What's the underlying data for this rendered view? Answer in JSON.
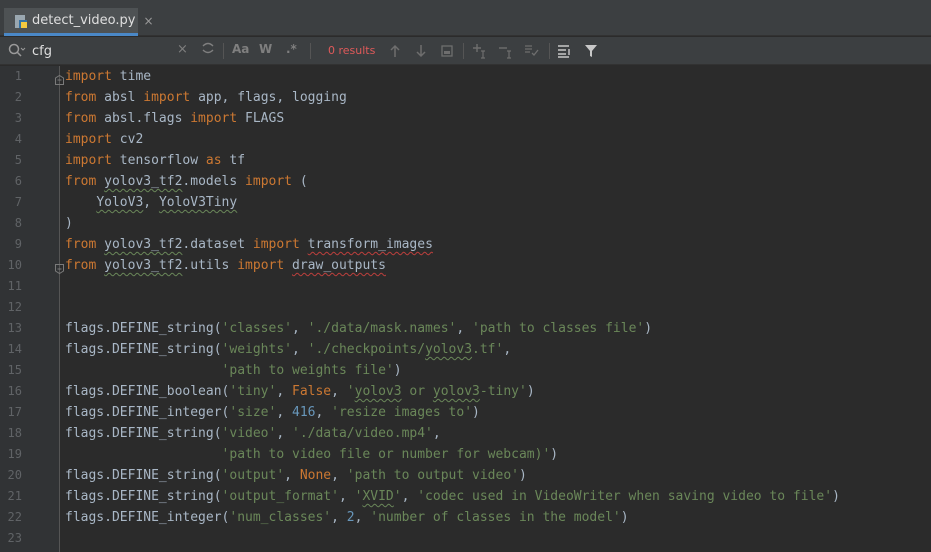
{
  "tab": {
    "label": "detect_video.py",
    "close": "×"
  },
  "find": {
    "query": "cfg",
    "clear": "×",
    "match_case": "Aa",
    "words": "W",
    "regex": ".*",
    "results": "0 results"
  },
  "lines": [
    {
      "n": "1",
      "tokens": [
        [
          "kw",
          "import"
        ],
        [
          "",
          " time"
        ]
      ]
    },
    {
      "n": "2",
      "tokens": [
        [
          "kw",
          "from"
        ],
        [
          "",
          " absl "
        ],
        [
          "kw",
          "import"
        ],
        [
          "",
          " app, flags, logging"
        ]
      ]
    },
    {
      "n": "3",
      "tokens": [
        [
          "kw",
          "from"
        ],
        [
          "",
          " absl.flags "
        ],
        [
          "kw",
          "import"
        ],
        [
          "",
          " FLAGS"
        ]
      ]
    },
    {
      "n": "4",
      "tokens": [
        [
          "kw",
          "import"
        ],
        [
          "",
          " cv2"
        ]
      ]
    },
    {
      "n": "5",
      "tokens": [
        [
          "kw",
          "import"
        ],
        [
          "",
          " tensorflow "
        ],
        [
          "kw",
          "as"
        ],
        [
          "",
          " tf"
        ]
      ]
    },
    {
      "n": "6",
      "tokens": [
        [
          "kw",
          "from"
        ],
        [
          "",
          " "
        ],
        [
          "sq",
          "yolov3_tf2"
        ],
        [
          "",
          ".models "
        ],
        [
          "kw",
          "import"
        ],
        [
          "",
          " ("
        ]
      ]
    },
    {
      "n": "7",
      "tokens": [
        [
          "",
          "    "
        ],
        [
          "sq",
          "YoloV3"
        ],
        [
          "",
          ", "
        ],
        [
          "sq",
          "YoloV3Tiny"
        ]
      ]
    },
    {
      "n": "8",
      "tokens": [
        [
          "",
          ")"
        ]
      ]
    },
    {
      "n": "9",
      "tokens": [
        [
          "kw",
          "from"
        ],
        [
          "",
          " "
        ],
        [
          "sq",
          "yolov3_tf2"
        ],
        [
          "",
          ".dataset "
        ],
        [
          "kw",
          "import"
        ],
        [
          "",
          " "
        ],
        [
          "sqr",
          "transform_images"
        ]
      ]
    },
    {
      "n": "10",
      "tokens": [
        [
          "kw",
          "from"
        ],
        [
          "",
          " "
        ],
        [
          "sq",
          "yolov3_tf2"
        ],
        [
          "",
          ".utils "
        ],
        [
          "kw",
          "import"
        ],
        [
          "",
          " "
        ],
        [
          "sqr",
          "draw_outputs"
        ]
      ]
    },
    {
      "n": "11",
      "tokens": []
    },
    {
      "n": "12",
      "tokens": []
    },
    {
      "n": "13",
      "tokens": [
        [
          "",
          "flags.DEFINE_string("
        ],
        [
          "str",
          "'classes'"
        ],
        [
          "",
          ", "
        ],
        [
          "str",
          "'./data/mask.names'"
        ],
        [
          "",
          ", "
        ],
        [
          "str",
          "'path to classes file'"
        ],
        [
          "",
          ")"
        ]
      ]
    },
    {
      "n": "14",
      "tokens": [
        [
          "",
          "flags.DEFINE_string("
        ],
        [
          "str",
          "'weights'"
        ],
        [
          "",
          ", "
        ],
        [
          "str",
          "'./checkpoints/"
        ],
        [
          "str sq",
          "yolov3"
        ],
        [
          "str",
          ".tf'"
        ],
        [
          "",
          ","
        ]
      ]
    },
    {
      "n": "15",
      "tokens": [
        [
          "",
          "                    "
        ],
        [
          "str",
          "'path to weights file'"
        ],
        [
          "",
          ")"
        ]
      ]
    },
    {
      "n": "16",
      "tokens": [
        [
          "",
          "flags.DEFINE_boolean("
        ],
        [
          "str",
          "'tiny'"
        ],
        [
          "",
          ", "
        ],
        [
          "kw",
          "False"
        ],
        [
          "",
          ", "
        ],
        [
          "str",
          "'"
        ],
        [
          "str sq",
          "yolov3"
        ],
        [
          "str",
          " or "
        ],
        [
          "str sq",
          "yolov3"
        ],
        [
          "str",
          "-tiny'"
        ],
        [
          "",
          ")"
        ]
      ]
    },
    {
      "n": "17",
      "tokens": [
        [
          "",
          "flags.DEFINE_integer("
        ],
        [
          "str",
          "'size'"
        ],
        [
          "",
          ", "
        ],
        [
          "num",
          "416"
        ],
        [
          "",
          ", "
        ],
        [
          "str",
          "'resize images to'"
        ],
        [
          "",
          ")"
        ]
      ]
    },
    {
      "n": "18",
      "tokens": [
        [
          "",
          "flags.DEFINE_string("
        ],
        [
          "str",
          "'video'"
        ],
        [
          "",
          ", "
        ],
        [
          "str",
          "'./data/video.mp4'"
        ],
        [
          "",
          ","
        ]
      ]
    },
    {
      "n": "19",
      "tokens": [
        [
          "",
          "                    "
        ],
        [
          "str",
          "'path to video file or number for webcam)'"
        ],
        [
          "",
          ")"
        ]
      ]
    },
    {
      "n": "20",
      "tokens": [
        [
          "",
          "flags.DEFINE_string("
        ],
        [
          "str",
          "'output'"
        ],
        [
          "",
          ", "
        ],
        [
          "kw",
          "None"
        ],
        [
          "",
          ", "
        ],
        [
          "str",
          "'path to output video'"
        ],
        [
          "",
          ")"
        ]
      ]
    },
    {
      "n": "21",
      "tokens": [
        [
          "",
          "flags.DEFINE_string("
        ],
        [
          "str",
          "'output_format'"
        ],
        [
          "",
          ", "
        ],
        [
          "str",
          "'"
        ],
        [
          "str sq",
          "XVID"
        ],
        [
          "str",
          "'"
        ],
        [
          "",
          ", "
        ],
        [
          "str",
          "'codec used in VideoWriter when saving video to file'"
        ],
        [
          "",
          ")"
        ]
      ]
    },
    {
      "n": "22",
      "tokens": [
        [
          "",
          "flags.DEFINE_integer("
        ],
        [
          "str",
          "'num_classes'"
        ],
        [
          "",
          ", "
        ],
        [
          "num",
          "2"
        ],
        [
          "",
          ", "
        ],
        [
          "str",
          "'number of classes in the model'"
        ],
        [
          "",
          ")"
        ]
      ]
    },
    {
      "n": "23",
      "tokens": []
    }
  ],
  "colors": {
    "keyword": "#cc7832",
    "string": "#6a8759",
    "number": "#6897bb",
    "text": "#a9b7c6",
    "results": "#e05a5a",
    "tab_accent": "#4a88c7"
  },
  "icons": [
    "python-file-icon",
    "search-icon",
    "replace-icon",
    "prev-occurrence-icon",
    "next-occurrence-icon",
    "select-all-icon",
    "add-selection-icon",
    "remove-selection-icon",
    "select-all-occurrences-icon",
    "multiline-icon",
    "filter-icon"
  ]
}
